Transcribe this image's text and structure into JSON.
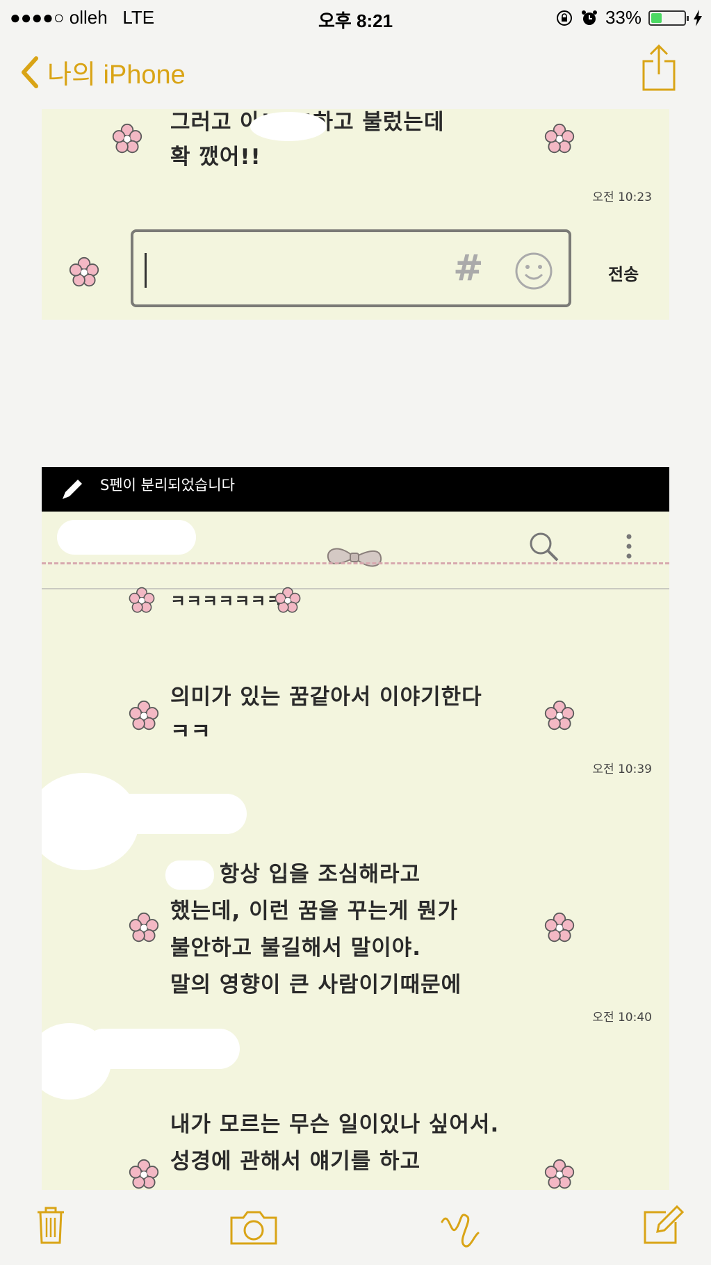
{
  "status": {
    "carrier": "●●●●○ olleh",
    "network": "LTE",
    "time": "오후 8:21",
    "battery": "33%",
    "battery_level": 0.33
  },
  "nav": {
    "back_label": "나의 iPhone",
    "accent": "#d9a416"
  },
  "shot1": {
    "message_lines": [
      "그러고      아!!!!!하고 불렀는데",
      "확 깼어!!"
    ],
    "time": "오전 10:23",
    "input": {
      "hash_icon": "hash-icon",
      "emoji_icon": "smiley-icon"
    },
    "send_label": "전송"
  },
  "shot2": {
    "spen_notice": "S펜이 분리되었습니다",
    "messages": [
      {
        "lines": [
          "ㅋㅋㅋㅋㅋㅋㅋ"
        ]
      },
      {
        "lines": [
          "의미가 있는 꿈같아서 이야기한다",
          "ㅋㅋ"
        ],
        "time": "오전 10:39"
      },
      {
        "lines": [
          "     이는 항상 입을 조심해라고",
          "했는데, 이런 꿈을 꾸는게 뭔가",
          "불안하고 불길해서 말이야.",
          "말의 영향이 큰 사람이기때문에"
        ],
        "time": "오전 10:40"
      },
      {
        "lines": [
          "내가 모르는 무슨 일이있나 싶어서.",
          "성경에 관해서 얘기를 하고"
        ]
      }
    ]
  },
  "toolbar": {
    "icons": [
      "trash-icon",
      "camera-icon",
      "sketch-icon",
      "compose-icon"
    ]
  }
}
